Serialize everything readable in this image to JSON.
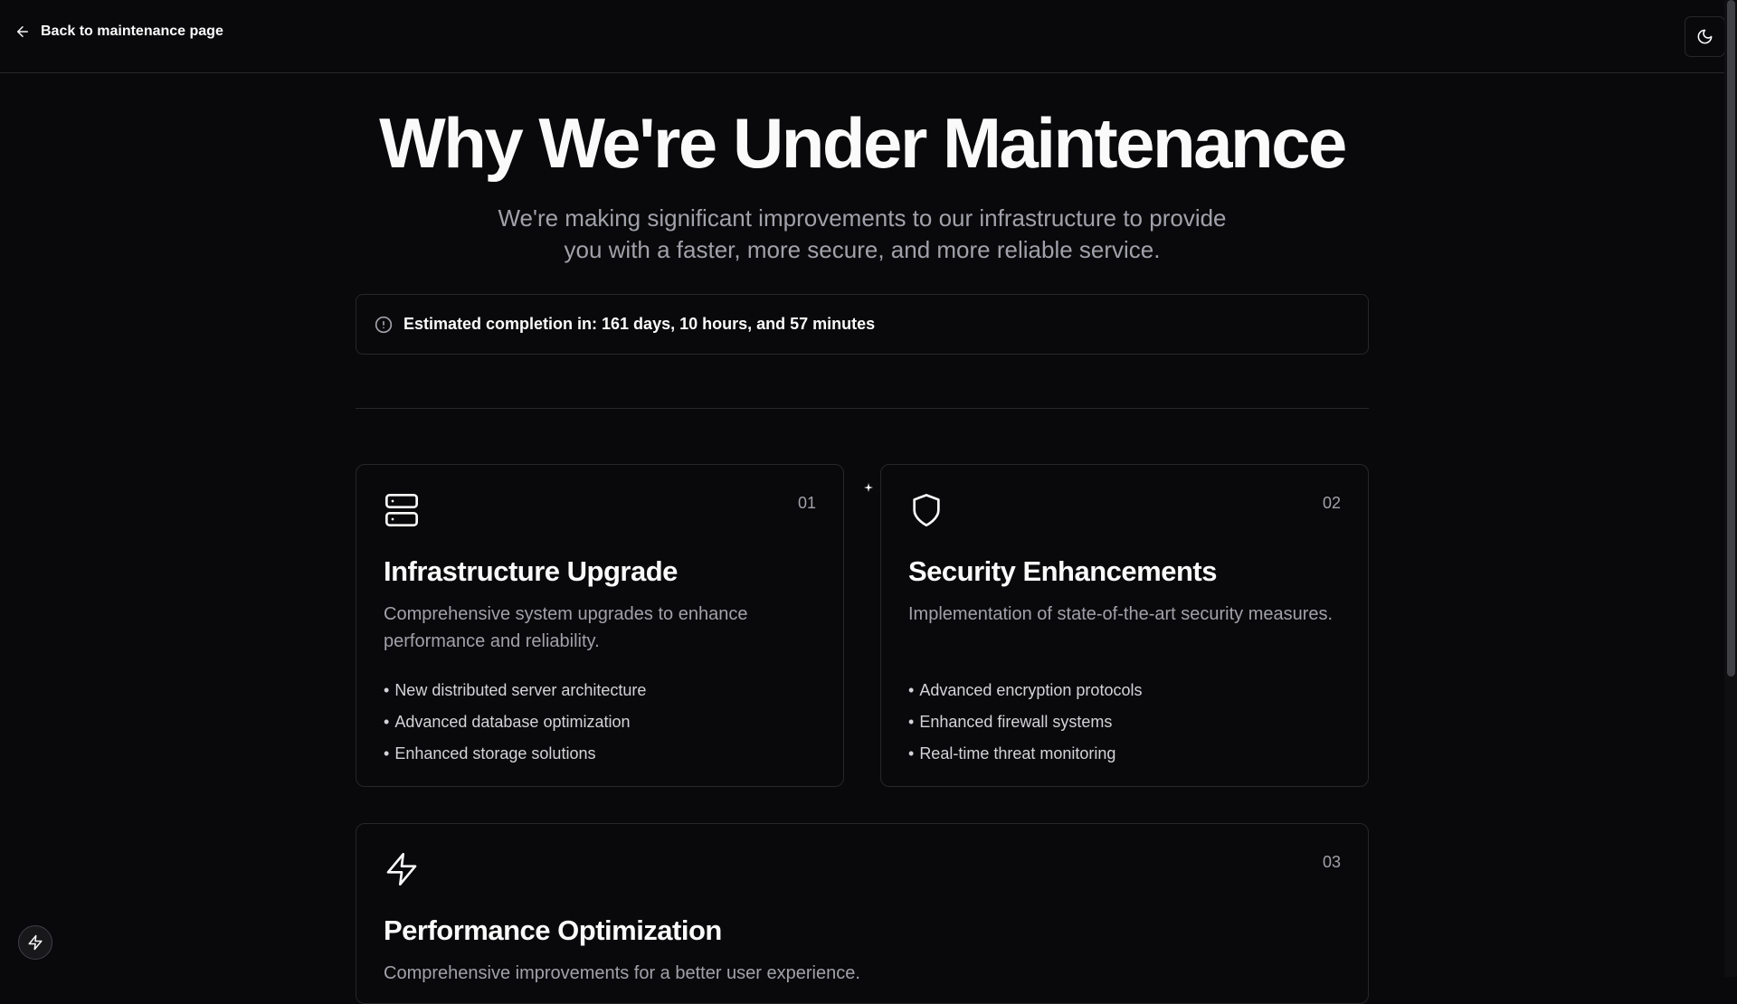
{
  "header": {
    "back_label": "Back to maintenance page",
    "theme_toggle_icon": "moon-icon"
  },
  "hero": {
    "title": "Why We're Under Maintenance",
    "subtitle": "We're making significant improvements to our infrastructure to provide you with a faster, more secure, and more reliable service."
  },
  "alert": {
    "icon": "alert-circle-icon",
    "text": "Estimated completion in: 161 days, 10 hours, and 57 minutes"
  },
  "cards": [
    {
      "number": "01",
      "icon": "server-icon",
      "title": "Infrastructure Upgrade",
      "description": "Comprehensive system upgrades to enhance performance and reliability.",
      "items": [
        "New distributed server architecture",
        "Advanced database optimization",
        "Enhanced storage solutions"
      ]
    },
    {
      "number": "02",
      "icon": "shield-icon",
      "title": "Security Enhancements",
      "description": "Implementation of state-of-the-art security measures.",
      "items": [
        "Advanced encryption protocols",
        "Enhanced firewall systems",
        "Real-time threat monitoring"
      ]
    },
    {
      "number": "03",
      "icon": "zap-icon",
      "title": "Performance Optimization",
      "description": "Comprehensive improvements for a better user experience."
    }
  ],
  "bullet": "•",
  "floating_button_icon": "zap-icon",
  "colors": {
    "background": "#09090b",
    "border": "#27272a",
    "foreground": "#fafafa",
    "muted": "#a1a1aa"
  }
}
